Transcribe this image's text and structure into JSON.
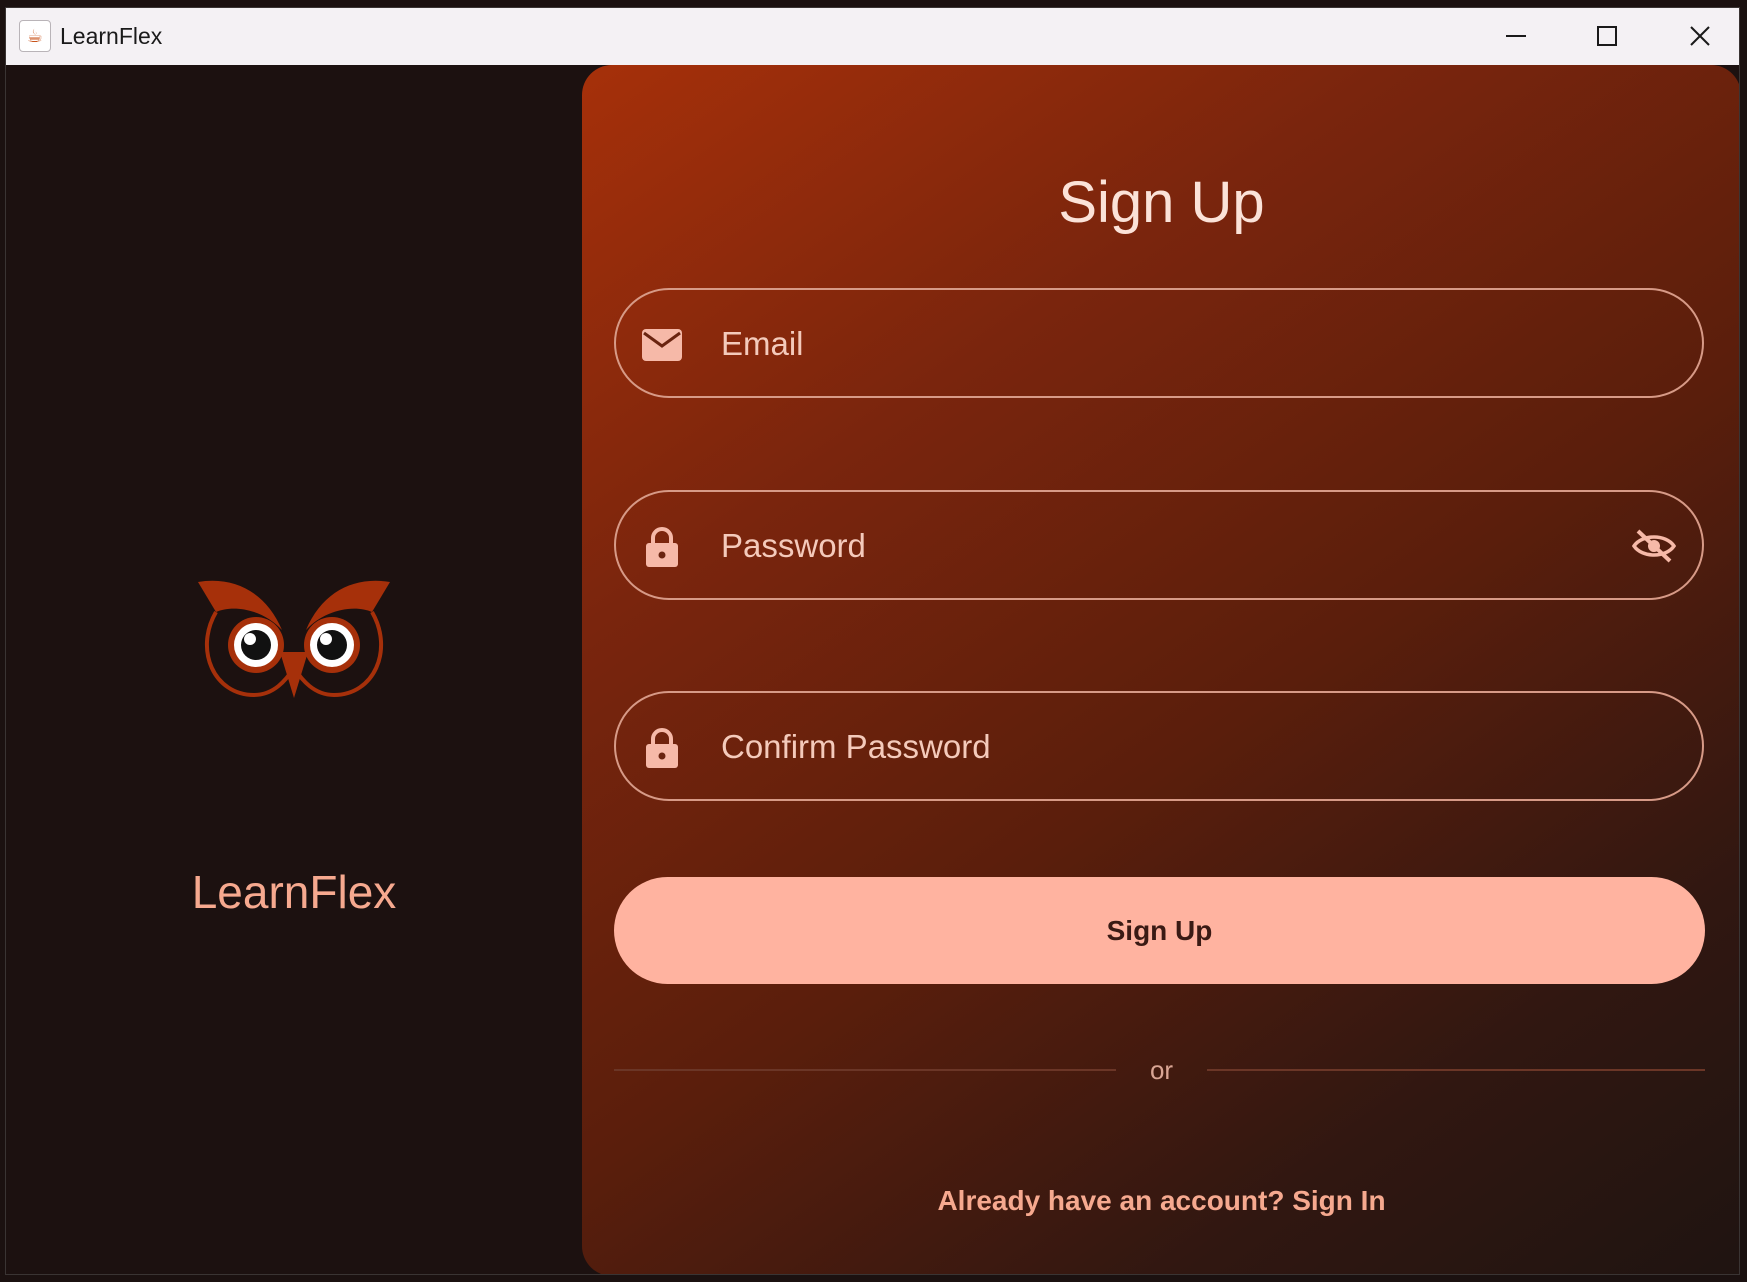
{
  "window": {
    "title": "LearnFlex",
    "controls": {
      "minimize": "minimize-icon",
      "maximize": "maximize-icon",
      "close": "close-icon"
    }
  },
  "brand": {
    "logo": "owl-logo",
    "name": "LearnFlex"
  },
  "form": {
    "title": "Sign Up",
    "email": {
      "icon": "envelope-icon",
      "placeholder": "Email",
      "value": ""
    },
    "password": {
      "icon": "lock-icon",
      "placeholder": "Password",
      "value": "",
      "toggle_icon": "eye-slash-icon"
    },
    "confirm_password": {
      "icon": "lock-icon",
      "placeholder": "Confirm Password",
      "value": ""
    },
    "submit_label": "Sign Up",
    "divider_text": "or",
    "signin_link": "Already have an account? Sign In"
  },
  "colors": {
    "accent": "#ffb3a0",
    "brand_text": "#f6a98f",
    "panel_start": "#a6300a",
    "panel_end": "#1f1411",
    "background": "#1c1110"
  }
}
